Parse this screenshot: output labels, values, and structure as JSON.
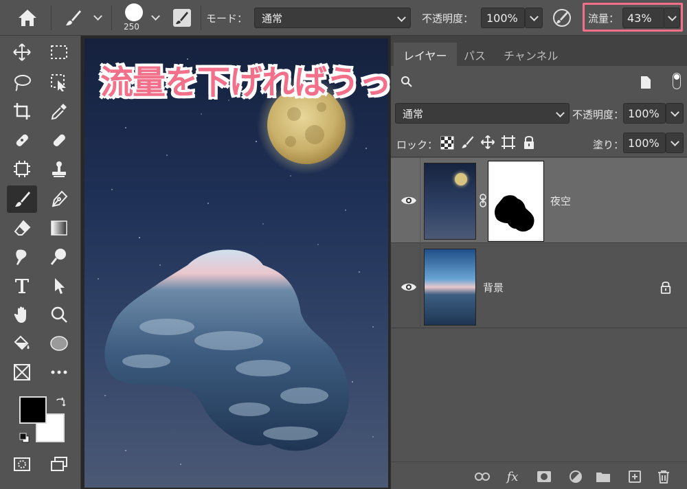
{
  "options_bar": {
    "brush_size": "250",
    "mode_label": "モード：",
    "mode_value": "通常",
    "opacity_label": "不透明度：",
    "opacity_value": "100%",
    "flow_label": "流量：",
    "flow_value": "43%"
  },
  "caption": "流量を下げればうっすら塗れる",
  "layers_panel": {
    "tabs": [
      "レイヤー",
      "パス",
      "チャンネル"
    ],
    "blend_mode": "通常",
    "opacity_label": "不透明度：",
    "opacity_value": "100%",
    "lock_label": "ロック：",
    "fill_label": "塗り：",
    "fill_value": "100%",
    "layers": [
      {
        "name": "夜空",
        "has_mask": true,
        "selected": true
      },
      {
        "name": "背景",
        "locked": true,
        "selected": false
      }
    ]
  },
  "colors": {
    "highlight": "#f2708a",
    "foreground": "#000000",
    "background": "#ffffff"
  }
}
